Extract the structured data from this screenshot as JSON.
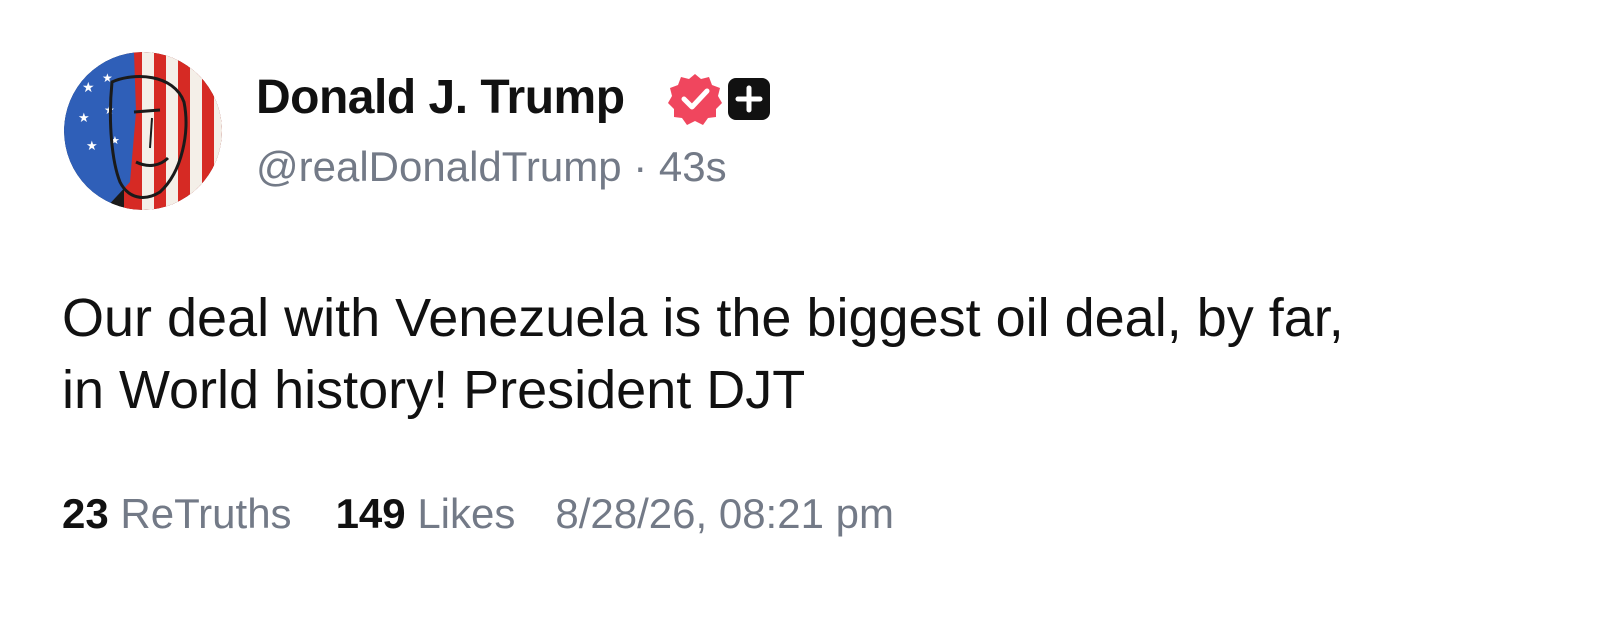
{
  "author": {
    "display_name": "Donald J. Trump",
    "handle": "@realDonaldTrump",
    "separator": " · ",
    "time_ago": "43s",
    "avatar_icon": "flag-portrait-avatar",
    "verified_icon": "verified-check-icon",
    "verified_color": "#f0465e",
    "plus_icon": "plus-icon"
  },
  "post": {
    "line1": "Our deal with Venezuela is the biggest oil deal, by far,",
    "line2": "in World history! President DJT"
  },
  "stats": {
    "retruths_count": "23",
    "retruths_label": "ReTruths",
    "likes_count": "149",
    "likes_label": "Likes",
    "timestamp": "8/28/26, 08:21 pm"
  }
}
